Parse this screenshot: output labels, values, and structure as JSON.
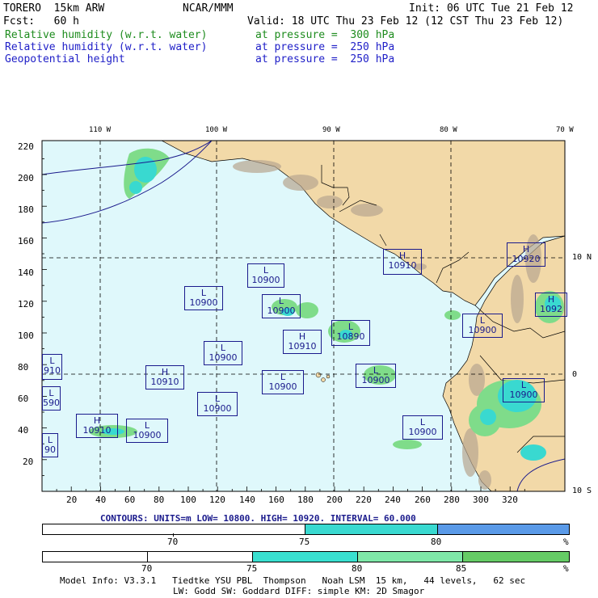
{
  "header": {
    "line1_left": "TORERO  15km ARW",
    "line1_mid": "NCAR/MMM",
    "line1_right": "Init: 06 UTC Tue 21 Feb 12",
    "line2_left": "Fcst:   60 h",
    "line2_right": "Valid: 18 UTC Thu 23 Feb 12 (12 CST Thu 23 Feb 12)",
    "fields": [
      {
        "name": "Relative humidity (w.r.t. water)",
        "level": "at pressure =  300 hPa",
        "color": "#1e8c1e"
      },
      {
        "name": "Relative humidity (w.r.t. water)",
        "level": "at pressure =  250 hPa",
        "color": "#2020c8"
      },
      {
        "name": "Geopotential height",
        "level": "at pressure =  250 hPa",
        "color": "#2020c8"
      }
    ]
  },
  "map": {
    "lon_labels": [
      "110 W",
      "100 W",
      "90 W",
      "80 W",
      "70 W"
    ],
    "lat_labels": [
      "10 N",
      "0",
      "10 S"
    ],
    "y_ticks": [
      "220",
      "200",
      "180",
      "160",
      "140",
      "120",
      "100",
      "80",
      "60",
      "40",
      "20"
    ],
    "x_ticks": [
      "20",
      "40",
      "60",
      "80",
      "100",
      "120",
      "140",
      "160",
      "180",
      "200",
      "220",
      "240",
      "260",
      "280",
      "300",
      "320"
    ],
    "colors": {
      "ocean": "#dff8fb",
      "land": "#f2d9a8",
      "grid": "#000000",
      "contour": "#1a1a8c",
      "rh_green": "#7fdc8a",
      "rh_cyan": "#39d9d0"
    },
    "centers": [
      {
        "type": "L",
        "value": "10900"
      },
      {
        "type": "L",
        "value": "10900"
      },
      {
        "type": "L",
        "value": "10900"
      },
      {
        "type": "H",
        "value": "10910"
      },
      {
        "type": "L",
        "value": "10890"
      },
      {
        "type": "L",
        "value": "10900"
      },
      {
        "type": "H",
        "value": "10910"
      },
      {
        "type": "L",
        "value": "10900"
      },
      {
        "type": "L",
        "value": "10900"
      },
      {
        "type": "L",
        "value": "10900"
      },
      {
        "type": "H",
        "value": "10910"
      },
      {
        "type": "L",
        "value": "10900"
      },
      {
        "type": "L",
        "value": "10900"
      },
      {
        "type": "H",
        "value": "10910"
      },
      {
        "type": "H",
        "value": "10920"
      },
      {
        "type": "H",
        "value": "1092"
      },
      {
        "type": "L",
        "value": "10900"
      },
      {
        "type": "L",
        "value": "10900"
      },
      {
        "type": "L",
        "value": "910"
      },
      {
        "type": "L",
        "value": "590"
      },
      {
        "type": "L",
        "value": "90"
      }
    ]
  },
  "contour_info": "CONTOURS:  UNITS=m  LOW=  10800.     HIGH=  10920.    INTERVAL=   60.000",
  "colorbar1": {
    "labels": [
      "70",
      "75",
      "80"
    ],
    "unit": "%",
    "colors": [
      "#ffffff",
      "#39d9d0",
      "#5a9ae8"
    ]
  },
  "colorbar2": {
    "labels": [
      "70",
      "75",
      "80",
      "85"
    ],
    "unit": "%",
    "colors": [
      "#ffffff",
      "#39e0d0",
      "#7fe8a8",
      "#66cc66"
    ]
  },
  "footer": {
    "line1": "Model Info: V3.3.1   Tiedtke YSU PBL  Thompson   Noah LSM  15 km,   44 levels,   62 sec",
    "line2": "LW: Godd SW: Goddard DIFF: simple KM: 2D Smagor"
  }
}
